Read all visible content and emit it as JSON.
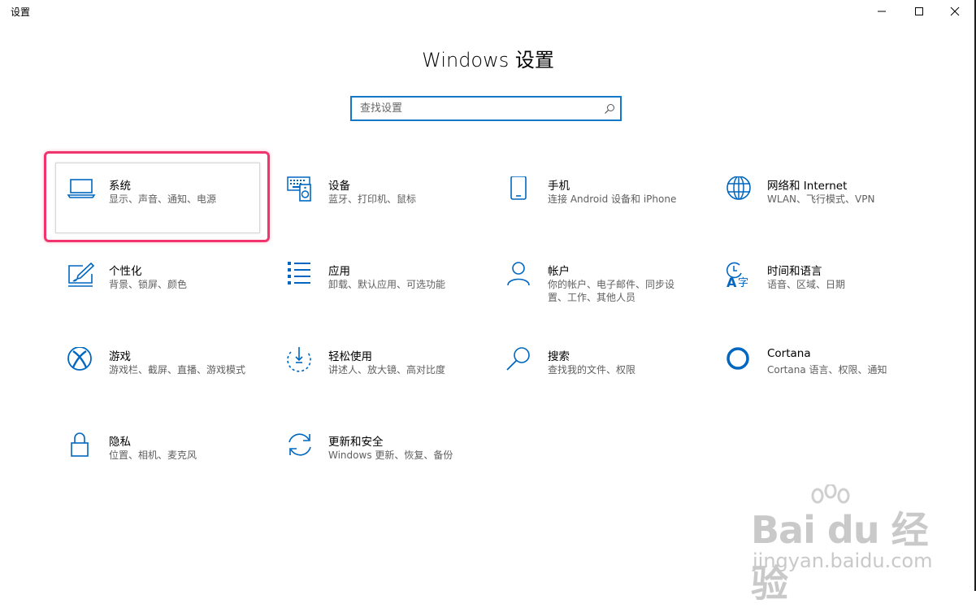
{
  "window": {
    "title": "设置"
  },
  "header": {
    "title": "Windows 设置"
  },
  "search": {
    "placeholder": "查找设置"
  },
  "tiles": [
    {
      "title": "系统",
      "desc": "显示、声音、通知、电源",
      "icon": "laptop-icon"
    },
    {
      "title": "设备",
      "desc": "蓝牙、打印机、鼠标",
      "icon": "keyboard-speaker-icon"
    },
    {
      "title": "手机",
      "desc": "连接 Android 设备和 iPhone",
      "icon": "phone-icon"
    },
    {
      "title": "网络和 Internet",
      "desc": "WLAN、飞行模式、VPN",
      "icon": "globe-icon"
    },
    {
      "title": "个性化",
      "desc": "背景、锁屏、颜色",
      "icon": "paint-icon"
    },
    {
      "title": "应用",
      "desc": "卸载、默认应用、可选功能",
      "icon": "apps-list-icon"
    },
    {
      "title": "帐户",
      "desc": "你的帐户、电子邮件、同步设置、工作、其他人员",
      "icon": "person-icon"
    },
    {
      "title": "时间和语言",
      "desc": "语音、区域、日期",
      "icon": "time-language-icon"
    },
    {
      "title": "游戏",
      "desc": "游戏栏、截屏、直播、游戏模式",
      "icon": "xbox-icon"
    },
    {
      "title": "轻松使用",
      "desc": "讲述人、放大镜、高对比度",
      "icon": "ease-of-access-icon"
    },
    {
      "title": "搜索",
      "desc": "查找我的文件、权限",
      "icon": "magnifier-icon"
    },
    {
      "title": "Cortana",
      "desc": "Cortana 语言、权限、通知",
      "icon": "cortana-icon"
    },
    {
      "title": "隐私",
      "desc": "位置、相机、麦克风",
      "icon": "lock-icon"
    },
    {
      "title": "更新和安全",
      "desc": "Windows 更新、恢复、备份",
      "icon": "sync-icon"
    }
  ],
  "watermark": {
    "main": "Bai du 经验",
    "sub": "jingyan.baidu.com"
  },
  "colors": {
    "accent": "#0067c0",
    "highlight": "#f0346e",
    "search_border": "#1478c8"
  }
}
